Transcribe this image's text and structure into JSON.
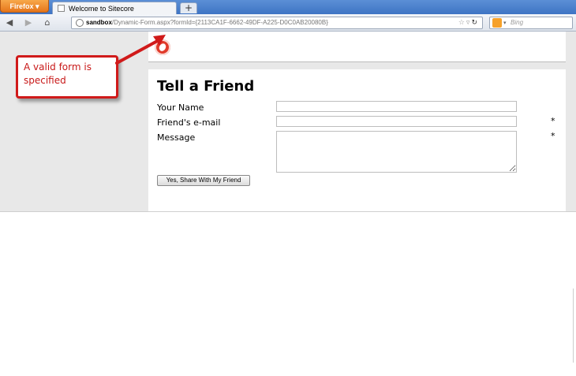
{
  "browser": {
    "app_button_label": "Firefox ▾",
    "tab_title": "Welcome to Sitecore",
    "new_tab_label": "+",
    "url_host": "sandbox",
    "url_path": "/Dynamic-Form.aspx?formId={2113CA1F-6662-49DF-A225-D0C0AB20080B}",
    "search_placeholder": "Bing",
    "icons": [
      "back-arrow-icon",
      "forward-arrow-icon",
      "home-icon",
      "globe-icon",
      "star-icon",
      "refresh-icon",
      "bing-icon"
    ]
  },
  "form": {
    "title": "Tell a Friend",
    "fields": [
      {
        "label": "Your Name",
        "required": ""
      },
      {
        "label": "Friend's e-mail",
        "required": "*"
      },
      {
        "label": "Message",
        "required": "*"
      }
    ],
    "submit_label": "Yes, Share With My Friend"
  },
  "callout": {
    "text": "A valid form is specified",
    "color": "#d01a1a"
  }
}
